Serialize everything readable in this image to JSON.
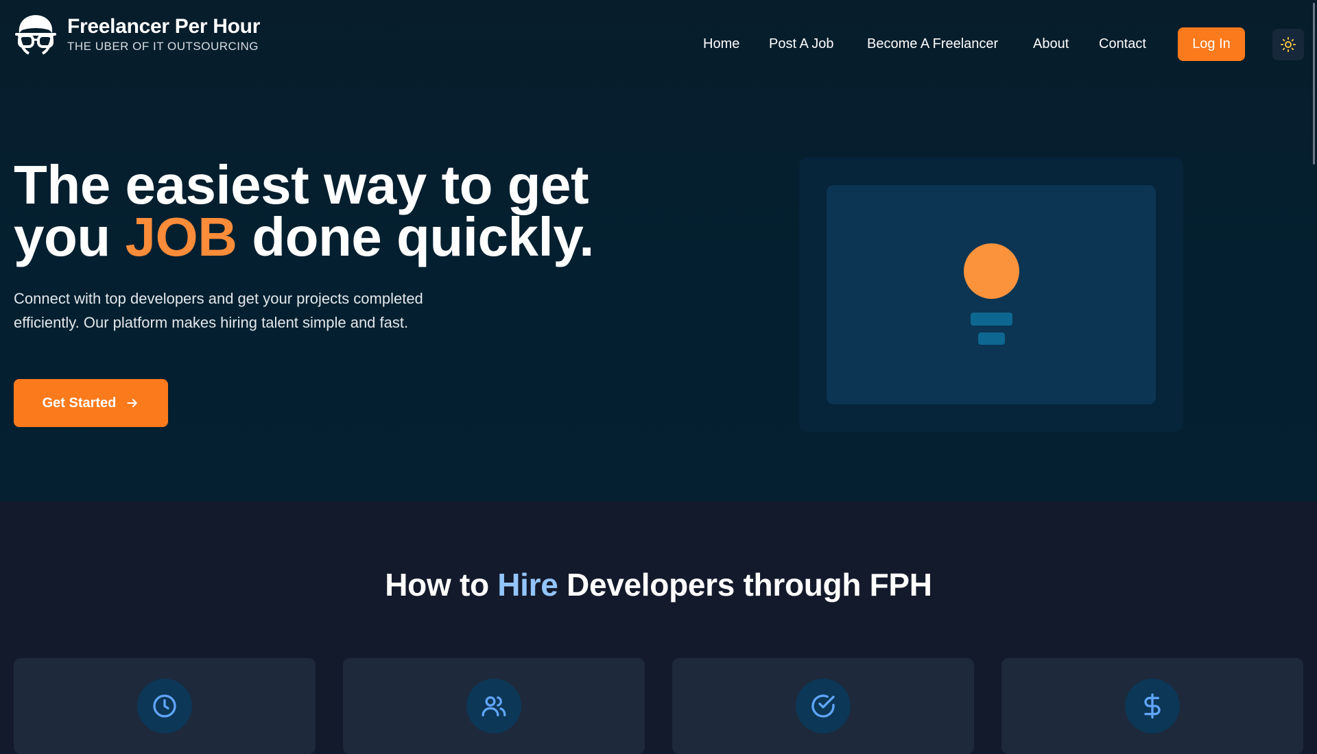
{
  "brand": {
    "name": "Freelancer Per Hour",
    "tagline": "THE UBER OF IT OUTSOURCING"
  },
  "nav": {
    "links": [
      "Home",
      "Post A Job",
      "Become A Freelancer",
      "About",
      "Contact"
    ],
    "login_label": "Log In",
    "theme_icon": "sun-icon"
  },
  "hero": {
    "headline_line1": "The easiest way to get",
    "headline_you": "you",
    "headline_accent": "JOB",
    "headline_rest": "done quickly.",
    "subtext": "Connect with top developers and get your projects completed efficiently. Our platform makes hiring talent simple and fast.",
    "cta_label": "Get Started"
  },
  "how_to": {
    "title_before": "How to",
    "title_highlight": "Hire",
    "title_after": "Developers through FPH",
    "card_icons": [
      "clock-icon",
      "users-icon",
      "check-circle-icon",
      "dollar-icon"
    ]
  },
  "colors": {
    "accent": "#fb7a1c",
    "highlight": "#93c5fd",
    "hero_bg": "#042030",
    "section_bg": "#131a2b"
  }
}
